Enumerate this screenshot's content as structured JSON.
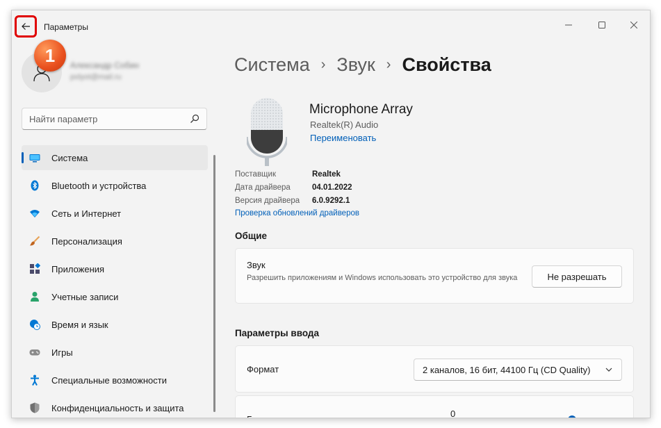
{
  "window": {
    "title": "Параметры",
    "back_icon": "arrow-left-icon",
    "controls": [
      "minimize-icon",
      "maximize-icon",
      "close-icon"
    ]
  },
  "annotation": {
    "step_number": "1",
    "color": "#e9501e",
    "highlight_color": "#e00000"
  },
  "profile": {
    "name": "Александр Собин",
    "email": "polyot@mail.ru"
  },
  "search": {
    "placeholder": "Найти параметр",
    "icon": "search-icon"
  },
  "sidebar": {
    "items": [
      {
        "label": "Система",
        "icon": "system-display-icon",
        "active": true
      },
      {
        "label": "Bluetooth и устройства",
        "icon": "bluetooth-icon"
      },
      {
        "label": "Сеть и Интернет",
        "icon": "wifi-icon"
      },
      {
        "label": "Персонализация",
        "icon": "paintbrush-icon"
      },
      {
        "label": "Приложения",
        "icon": "apps-icon"
      },
      {
        "label": "Учетные записи",
        "icon": "person-icon"
      },
      {
        "label": "Время и язык",
        "icon": "globe-clock-icon"
      },
      {
        "label": "Игры",
        "icon": "gamepad-icon"
      },
      {
        "label": "Специальные возможности",
        "icon": "accessibility-icon"
      },
      {
        "label": "Конфиденциальность и защита",
        "icon": "shield-icon"
      }
    ]
  },
  "breadcrumb": {
    "parts": [
      "Система",
      "Звук"
    ],
    "current": "Свойства"
  },
  "device": {
    "name": "Microphone Array",
    "vendor": "Realtek(R) Audio",
    "rename_label": "Переименовать",
    "icon": "microphone-icon"
  },
  "driver": {
    "rows": [
      {
        "key": "Поставщик",
        "value": "Realtek"
      },
      {
        "key": "Дата драйвера",
        "value": "04.01.2022"
      },
      {
        "key": "Версия драйвера",
        "value": "6.0.9292.1"
      }
    ],
    "update_link": "Проверка обновлений драйверов"
  },
  "general": {
    "title": "Общие",
    "audio": {
      "title": "Звук",
      "description": "Разрешить приложениям и Windows использовать это устройство для звука",
      "button_label": "Не разрешать"
    }
  },
  "input": {
    "title": "Параметры ввода",
    "format": {
      "label": "Формат",
      "value": "2 каналов, 16 бит, 44100 Гц (CD Quality)"
    }
  },
  "colors": {
    "accent": "#005fb8",
    "window_bg": "#f3f3f3",
    "card_bg": "#fbfbfb"
  }
}
